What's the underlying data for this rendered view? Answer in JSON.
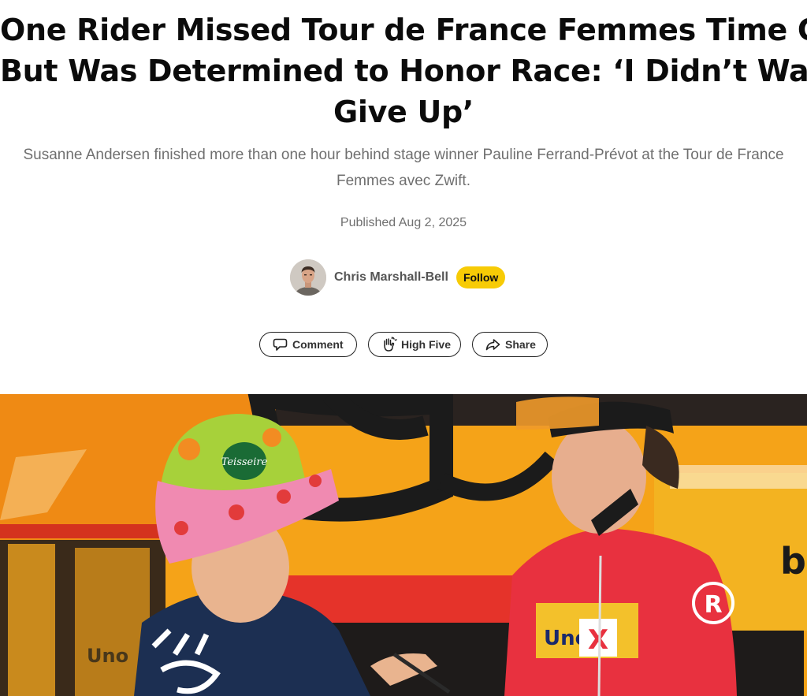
{
  "article": {
    "headline_lines": [
      "One Rider Missed Tour de France Femmes Time Cut",
      "But Was Determined to Honor Race: ‘I Didn’t Want to",
      "Give Up’"
    ],
    "subhead_lines": [
      "Susanne Andersen finished more than one hour behind stage winner Pauline Ferrand-Prévot at the Tour de France",
      "Femmes avec Zwift."
    ],
    "published": "Published Aug 2, 2025"
  },
  "author": {
    "name": "Chris Marshall-Bell",
    "follow_label": "Follow",
    "avatar_icon": "avatar"
  },
  "actions": {
    "comment_label": "Comment",
    "comment_icon": "comment-bubble-icon",
    "high_five_label": "High Five",
    "high_five_icon": "raised-hand-icon",
    "share_label": "Share",
    "share_icon": "share-arrow-icon"
  },
  "hero_image": {
    "hat_text": "Teisseire",
    "jersey_text": "Uno",
    "jersey_logo": "X",
    "sleeve_letter": "R",
    "bus_letter": "b",
    "bus_text": "Uno"
  },
  "colors": {
    "follow_bg": "#f7cb05",
    "jersey_red": "#e8313f",
    "bus_orange": "#f39a12"
  }
}
